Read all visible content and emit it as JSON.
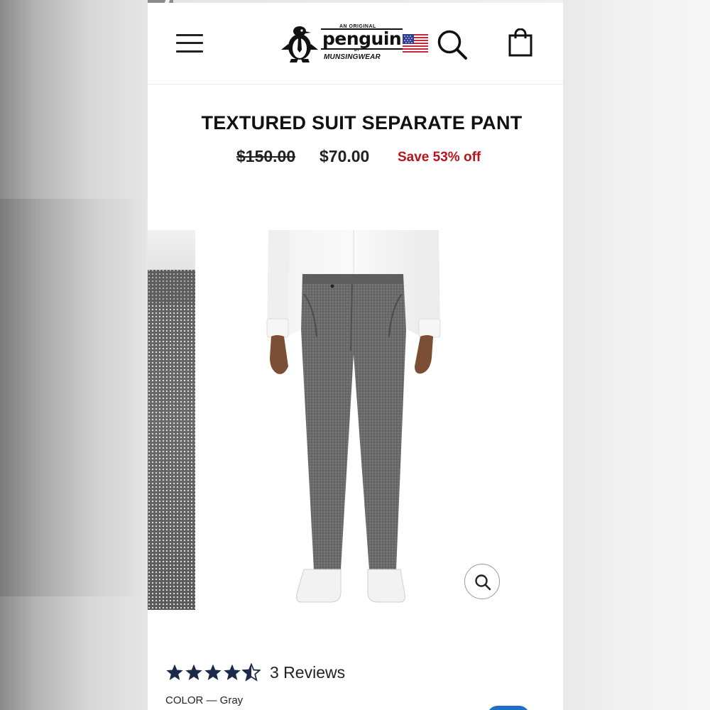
{
  "header": {
    "logo": {
      "tagline": "AN ORIGINAL",
      "brand": "penguin",
      "by": "BY",
      "sub_brand": "MUNSINGWEAR"
    },
    "icons": [
      "menu-icon",
      "us-flag-icon",
      "search-icon",
      "shopping-bag-icon"
    ]
  },
  "product": {
    "title": "TEXTURED SUIT SEPARATE PANT",
    "original_price": "$150.00",
    "sale_price": "$70.00",
    "savings": "Save 53% off",
    "sale_color": "#b8141b",
    "rating": {
      "value": 4.5,
      "max": 5,
      "reviews_label": "3 Reviews",
      "star_color": "#1c2a4a"
    },
    "color_label": "COLOR — Gray"
  },
  "gallery": {
    "zoom_icon": "magnifier-icon"
  }
}
